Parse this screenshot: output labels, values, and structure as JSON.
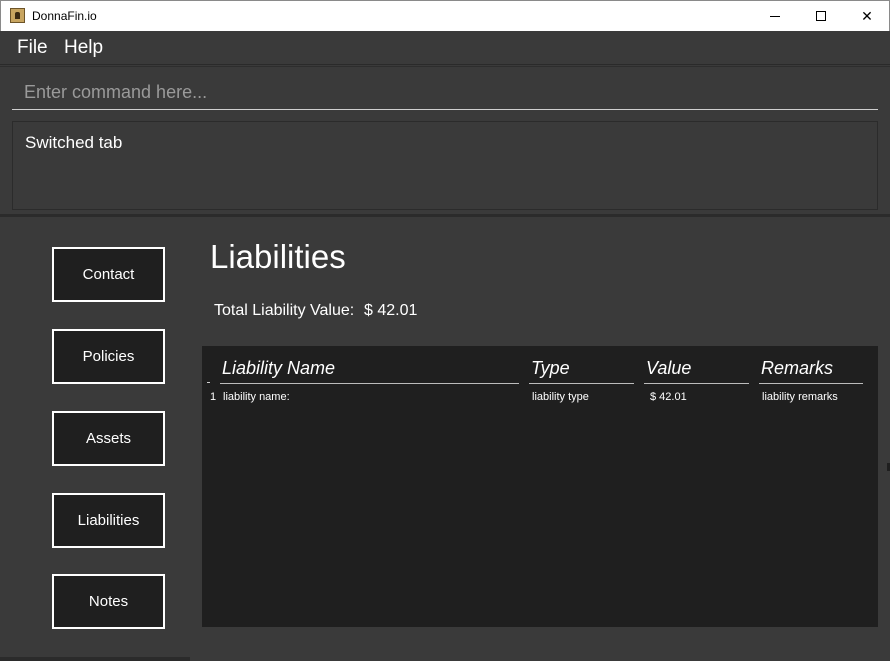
{
  "window": {
    "title": "DonnaFin.io",
    "icon": "donnafin-app-icon"
  },
  "controls": {
    "minimize": "minimize-icon",
    "maximize": "maximize-icon",
    "close": "✕"
  },
  "menu": {
    "file": "File",
    "help": "Help"
  },
  "command": {
    "placeholder": "Enter command here...",
    "value": ""
  },
  "result": {
    "text": "Switched tab"
  },
  "nav": {
    "contact": "Contact",
    "policies": "Policies",
    "assets": "Assets",
    "liabilities": "Liabilities",
    "notes": "Notes"
  },
  "main": {
    "title": "Liabilities",
    "total_label": "Total Liability Value:",
    "total_value": "$ 42.01"
  },
  "table": {
    "headers": [
      "Liability Name",
      "Type",
      "Value",
      "Remarks"
    ],
    "rows": [
      {
        "index": "1",
        "name": "liability name:",
        "type": "liability type",
        "value": "$ 42.01",
        "remarks": "liability remarks"
      }
    ]
  }
}
